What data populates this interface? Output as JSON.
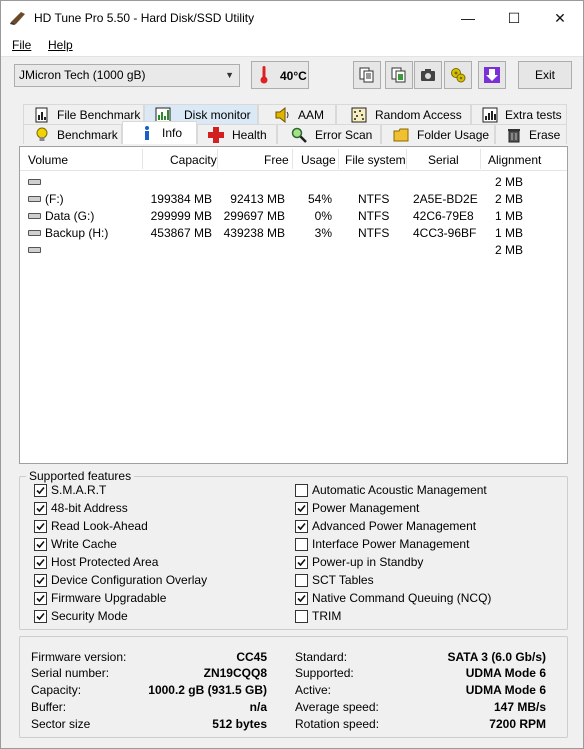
{
  "window": {
    "title": "HD Tune Pro 5.50 - Hard Disk/SSD Utility",
    "minimize": "—",
    "maximize": "☐",
    "close": "✕"
  },
  "menu": {
    "file": "File",
    "help": "Help"
  },
  "toolbar": {
    "drive": "JMicron Tech (1000 gB)",
    "temperature": "40°C",
    "exit_label": "Exit",
    "icons": [
      "copy-text-icon",
      "copy-screenshot-icon",
      "camera-icon",
      "settings-icon",
      "save-down-icon"
    ]
  },
  "tabs_top": [
    {
      "label": "File Benchmark",
      "icon": "file-benchmark-icon"
    },
    {
      "label": "Disk monitor",
      "icon": "disk-monitor-icon"
    },
    {
      "label": "AAM",
      "icon": "speaker-icon"
    },
    {
      "label": "Random Access",
      "icon": "random-access-icon"
    },
    {
      "label": "Extra tests",
      "icon": "extra-tests-icon"
    }
  ],
  "tabs_bottom": [
    {
      "label": "Benchmark",
      "icon": "bulb-icon"
    },
    {
      "label": "Info",
      "icon": "info-icon"
    },
    {
      "label": "Health",
      "icon": "health-cross-icon"
    },
    {
      "label": "Error Scan",
      "icon": "magnifier-icon"
    },
    {
      "label": "Folder Usage",
      "icon": "folder-icon"
    },
    {
      "label": "Erase",
      "icon": "trash-icon"
    }
  ],
  "volumes": {
    "headers": [
      "Volume",
      "Capacity",
      "Free",
      "Usage",
      "File system",
      "Serial",
      "Alignment"
    ],
    "rows": [
      {
        "volume": "",
        "capacity": "",
        "free": "",
        "usage": "",
        "fs": "",
        "serial": "",
        "alignment": "2 MB"
      },
      {
        "volume": "(F:)",
        "capacity": "199384 MB",
        "free": "92413 MB",
        "usage": "54%",
        "fs": "NTFS",
        "serial": "2A5E-BD2E",
        "alignment": "2 MB"
      },
      {
        "volume": "Data (G:)",
        "capacity": "299999 MB",
        "free": "299697 MB",
        "usage": "0%",
        "fs": "NTFS",
        "serial": "42C6-79E8",
        "alignment": "1 MB"
      },
      {
        "volume": "Backup (H:)",
        "capacity": "453867 MB",
        "free": "439238 MB",
        "usage": "3%",
        "fs": "NTFS",
        "serial": "4CC3-96BF",
        "alignment": "1 MB"
      },
      {
        "volume": "",
        "capacity": "",
        "free": "",
        "usage": "",
        "fs": "",
        "serial": "",
        "alignment": "2 MB"
      }
    ]
  },
  "features": {
    "title": "Supported features",
    "left": [
      {
        "label": "S.M.A.R.T",
        "checked": true
      },
      {
        "label": "48-bit Address",
        "checked": true
      },
      {
        "label": "Read Look-Ahead",
        "checked": true
      },
      {
        "label": "Write Cache",
        "checked": true
      },
      {
        "label": "Host Protected Area",
        "checked": true
      },
      {
        "label": "Device Configuration Overlay",
        "checked": true
      },
      {
        "label": "Firmware Upgradable",
        "checked": true
      },
      {
        "label": "Security Mode",
        "checked": true
      }
    ],
    "right": [
      {
        "label": "Automatic Acoustic Management",
        "checked": false
      },
      {
        "label": "Power Management",
        "checked": true
      },
      {
        "label": "Advanced Power Management",
        "checked": true
      },
      {
        "label": "Interface Power Management",
        "checked": false
      },
      {
        "label": "Power-up in Standby",
        "checked": true
      },
      {
        "label": "SCT Tables",
        "checked": false
      },
      {
        "label": "Native Command Queuing (NCQ)",
        "checked": true
      },
      {
        "label": "TRIM",
        "checked": false
      }
    ]
  },
  "info": {
    "left": [
      {
        "label": "Firmware version:",
        "value": "CC45"
      },
      {
        "label": "Serial number:",
        "value": "ZN19CQQ8"
      },
      {
        "label": "Capacity:",
        "value": "1000.2 gB (931.5 GB)"
      },
      {
        "label": "Buffer:",
        "value": "n/a"
      },
      {
        "label": "Sector size",
        "value": "512 bytes"
      }
    ],
    "right": [
      {
        "label": "Standard:",
        "value": "SATA 3 (6.0 Gb/s)"
      },
      {
        "label": "Supported:",
        "value": "UDMA Mode 6"
      },
      {
        "label": "Active:",
        "value": "UDMA Mode 6"
      },
      {
        "label": "Average speed:",
        "value": "147 MB/s"
      },
      {
        "label": "Rotation speed:",
        "value": "7200 RPM"
      }
    ]
  },
  "colors": {
    "accent_purple": "#7b2fd6",
    "health_red": "#d21f1f",
    "selected_tab": "#ffffff",
    "hover_tab": "#dbe9f6"
  }
}
